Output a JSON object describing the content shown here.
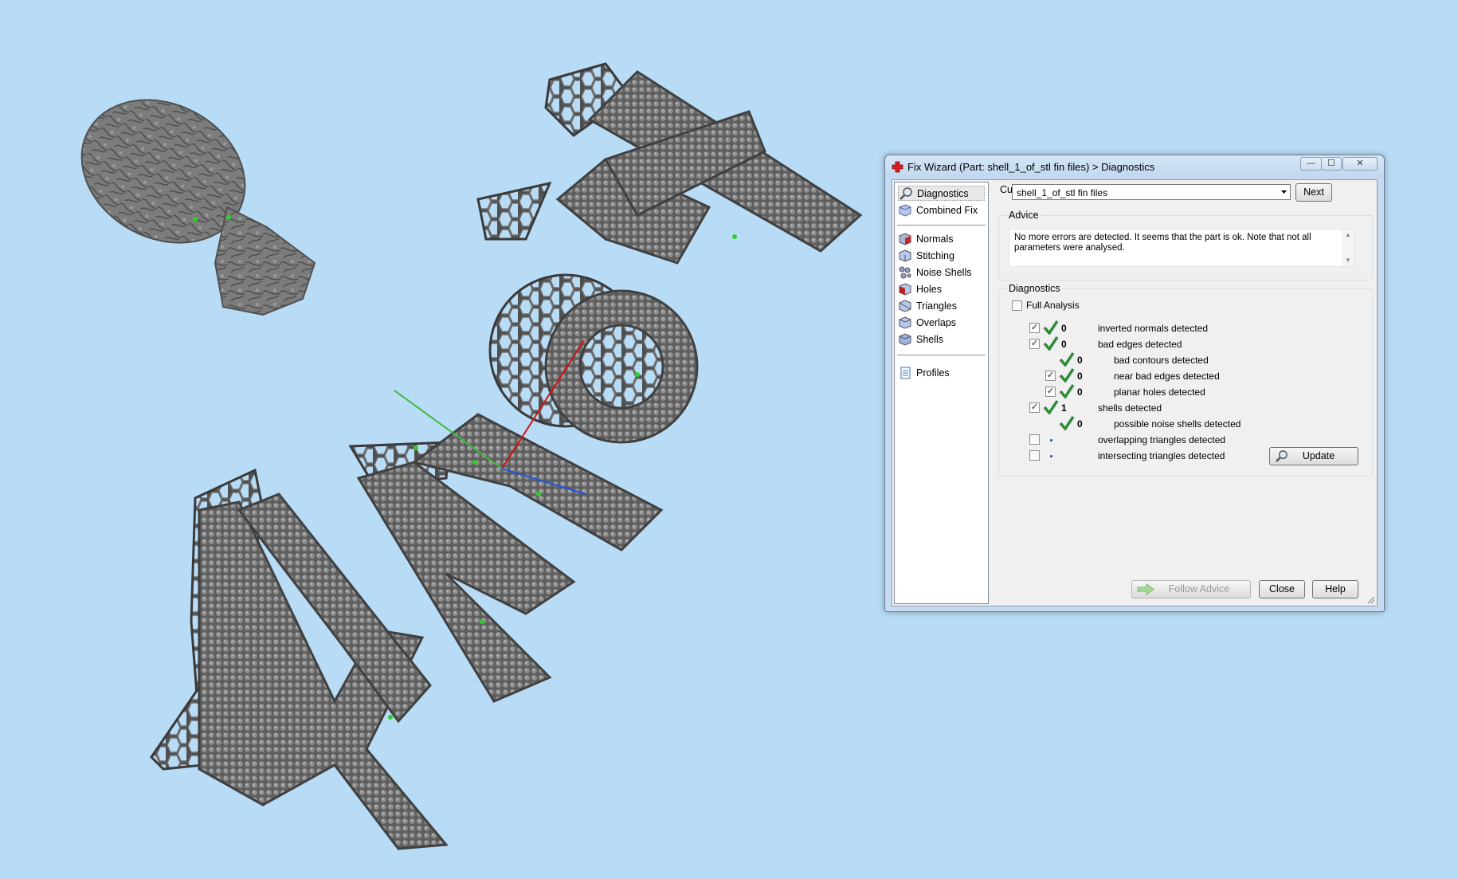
{
  "window": {
    "title": "Fix Wizard (Part: shell_1_of_stl fin files) > Diagnostics",
    "min_label": "—",
    "max_label": "☐",
    "close_label": "✕"
  },
  "nav": {
    "items": [
      {
        "label": "Diagnostics",
        "icon": "magnifier-icon"
      },
      {
        "label": "Combined Fix",
        "icon": "cube-icon"
      },
      {
        "label": "Normals",
        "icon": "normals-cube-icon"
      },
      {
        "label": "Stitching",
        "icon": "stitching-cube-icon"
      },
      {
        "label": "Noise Shells",
        "icon": "noise-shells-icon"
      },
      {
        "label": "Holes",
        "icon": "holes-cube-icon"
      },
      {
        "label": "Triangles",
        "icon": "triangles-cube-icon"
      },
      {
        "label": "Overlaps",
        "icon": "overlaps-cube-icon"
      },
      {
        "label": "Shells",
        "icon": "shells-cube-icon"
      },
      {
        "label": "Profiles",
        "icon": "profiles-icon"
      }
    ]
  },
  "part": {
    "label": "Current Part:",
    "value": "shell_1_of_stl fin files",
    "next_label": "Next"
  },
  "advice": {
    "title": "Advice",
    "text": "No more errors are detected. It seems that the part is ok. Note that not all parameters were analysed."
  },
  "diagnostics": {
    "title": "Diagnostics",
    "full_analysis_label": "Full Analysis",
    "full_analysis_checked": false,
    "rows": [
      {
        "checkbox": true,
        "checked": true,
        "status": "ok",
        "count": "0",
        "label": "inverted normals detected",
        "indent": 0
      },
      {
        "checkbox": true,
        "checked": true,
        "status": "ok",
        "count": "0",
        "label": "bad edges detected",
        "indent": 0
      },
      {
        "checkbox": false,
        "checked": false,
        "status": "ok",
        "count": "0",
        "label": "bad contours detected",
        "indent": 1
      },
      {
        "checkbox": true,
        "checked": true,
        "status": "ok",
        "count": "0",
        "label": "near bad edges detected",
        "indent": 1
      },
      {
        "checkbox": true,
        "checked": true,
        "status": "ok",
        "count": "0",
        "label": "planar holes detected",
        "indent": 1
      },
      {
        "checkbox": true,
        "checked": true,
        "status": "ok",
        "count": "1",
        "label": "shells detected",
        "indent": 0
      },
      {
        "checkbox": false,
        "checked": false,
        "status": "ok",
        "count": "0",
        "label": "possible noise shells detected",
        "indent": 1
      },
      {
        "checkbox": true,
        "checked": false,
        "status": "none",
        "count": "",
        "label": "overlapping triangles detected",
        "indent": 0
      },
      {
        "checkbox": true,
        "checked": false,
        "status": "none",
        "count": "",
        "label": "intersecting triangles detected",
        "indent": 0
      }
    ],
    "update_label": "Update"
  },
  "footer": {
    "follow_advice_label": "Follow Advice",
    "close_label": "Close",
    "help_label": "Help"
  },
  "colors": {
    "background": "#b9dcf6",
    "model": "#6e6e6e",
    "check_green": "#2e8b3a",
    "axis_x": "#d01010",
    "axis_y": "#3cb83c",
    "axis_z": "#2255dd"
  }
}
